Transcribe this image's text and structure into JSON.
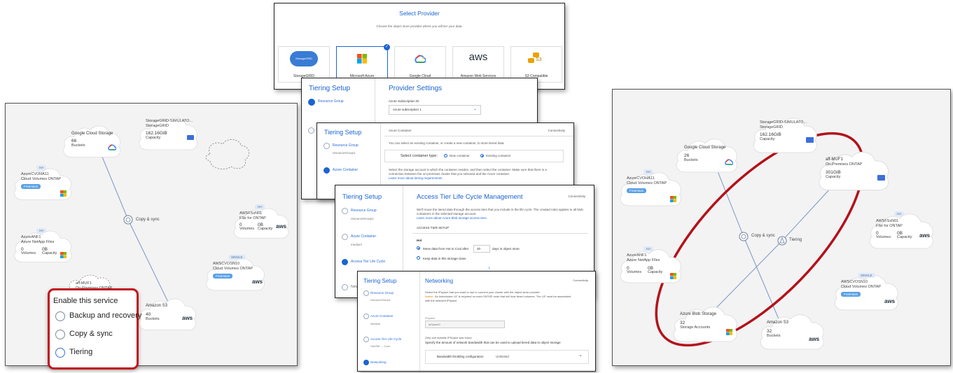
{
  "left_canvas": {
    "gcs": {
      "title": "Google Cloud Storage",
      "value": "66",
      "unit": "Buckets"
    },
    "sgrid": {
      "title": "StorageGRID-SIMULATO...",
      "subtitle": "StorageGRID",
      "value": "162.16GiB",
      "unit": "Capacity"
    },
    "azha": {
      "tag": "HA",
      "title": "AzureCVOHA11",
      "subtitle": "Cloud Volumes ONTAP",
      "badge": "Freemium"
    },
    "anf": {
      "tag": "HA",
      "title": "AzureANF1",
      "subtitle": "Azure NetApp Files",
      "v1": "0",
      "l1": "Volumes",
      "v2": "0B",
      "l2": "Capacity"
    },
    "fsx": {
      "tag": "HA",
      "title": "AWSFSxN01",
      "subtitle": "FSx for ONTAP",
      "v1": "0",
      "l1": "Volumes",
      "v2": "0B",
      "l2": "Capacity"
    },
    "cvo": {
      "tag": "SINGLE",
      "title": "AWSCVOSN10",
      "subtitle": "Cloud Volumes ONTAP",
      "badge": "Freemium"
    },
    "s3": {
      "title": "Amazon S3",
      "value": "40",
      "unit": "Buckets"
    },
    "copy_sync": "Copy & sync",
    "partial": "aff-MUF1",
    "partial2": "On-Premises ONTAP"
  },
  "enable_menu": {
    "title": "Enable this service",
    "items": [
      "Backup and recovery",
      "Copy & sync",
      "Tiering"
    ]
  },
  "select_provider": {
    "title": "Select Provider",
    "subtitle": "Choose the object store provider where you will tier your data.",
    "providers": [
      {
        "name": "StorageGRID",
        "logo": "StorageGRID"
      },
      {
        "name": "Microsoft Azure"
      },
      {
        "name": "Google Cloud"
      },
      {
        "name": "Amazon Web Services",
        "logo": "aws"
      },
      {
        "name": "S3 Compatible",
        "logo": "S3"
      }
    ]
  },
  "panel1": {
    "title": "Tiering Setup",
    "heading": "Provider Settings",
    "step": "Resource Group",
    "field_label": "Azure Subscription ID",
    "field_value": "Azure subscription 1"
  },
  "panel2": {
    "title": "Tiering Setup",
    "step1": "Resource Group",
    "step1_sub": "resourceGroup1",
    "step2": "Azure Container",
    "section": "Azure Container",
    "connectivity": "Connectivity",
    "desc": "You can select an existing container, or create a new container, to store tiered data.",
    "select_label": "Select container type:",
    "opt_new": "New container",
    "opt_existing": "Existing container",
    "note": "Select the storage account in which the container resides, and then select the container. Make sure that there is a",
    "note2": "connection between the on-premises cluster that you selected and the Azure container.",
    "link": "Learn more about tiering requirements"
  },
  "panel3": {
    "title": "Tiering Setup",
    "heading": "Access Tier Life Cycle Management",
    "connectivity": "Connectivity",
    "step1": "Resource Group",
    "step1_sub": "resourceGroup1",
    "step2": "Azure Container",
    "step2_sub": "medium",
    "step3": "Access Tier Life Cycle",
    "step4": "Netw",
    "desc1": "We'll move the tiered data through the access tiers that you include in the life cycle. The created rules applies to all blob",
    "desc2": "containers in the selected storage account.",
    "link": "Learn more about Azure Blob storage access tiers",
    "section": "ACCESS TIER SETUP",
    "hot": "Hot",
    "move_label": "Move data from Hot to Cool after",
    "move_days": "30",
    "move_suffix": "days in object store",
    "keep_label": "Keep data in this storage class"
  },
  "panel4": {
    "title": "Tiering Setup",
    "heading": "Networking",
    "connectivity": "Connectivity",
    "step1": "Resource Group",
    "step1_sub": "resourceGroup1",
    "step2": "Azure Container",
    "step2_sub": "medium",
    "step3": "Access Tier Life Cycle",
    "step3_sub": "Hot/Std → Cool",
    "step4": "Networking",
    "desc": "Select the IPspace that you want to use to connect your cluster with the object store provider.",
    "notice_label": "Notice:",
    "notice": "An Intercluster LIF is required on each ONTAP node that will host tiered volumes. The LIF must be associated",
    "notice2": "with the selected IPspace.",
    "ipspace_label": "IPspace",
    "ipspace_value": "ipSpace0",
    "found": "Only one suitable IPSpace was found",
    "bandwidth_desc": "Specify the amount of network bandwidth that can be used to upload tiered data to object storage",
    "bandwidth_label": "Bandwidth throttling configuration",
    "bandwidth_value": "Unlimited"
  },
  "right_canvas": {
    "gcs": {
      "title": "Google Cloud Storage",
      "value": "26",
      "unit": "Buckets"
    },
    "sgrid": {
      "title": "StorageGRID-SIMULATO...",
      "subtitle": "StorageGRID",
      "value": "162.16GiB",
      "unit": "Capacity"
    },
    "aff": {
      "title": "aff-MUF1",
      "subtitle": "On-Premises ONTAP",
      "value": "301GiB",
      "unit": "Capacity"
    },
    "azha": {
      "tag": "HA",
      "title": "AzureCVOHA11",
      "subtitle": "Cloud Volumes ONTAP",
      "badge": "Freemium"
    },
    "fsx": {
      "tag": "HA",
      "title": "AWSFSxN01",
      "subtitle": "FSx for ONTAP",
      "v1": "0",
      "l1": "Volumes",
      "v2": "0B",
      "l2": "Capacity"
    },
    "anf": {
      "tag": "HA",
      "title": "AzureANF1",
      "subtitle": "Azure NetApp Files",
      "v1": "0",
      "l1": "Volumes",
      "v2": "0B",
      "l2": "Capacity"
    },
    "cvo": {
      "tag": "SINGLE",
      "title": "AWSCVOSN10",
      "subtitle": "Cloud Volumes ONTAP",
      "badge": "Freemium"
    },
    "blob": {
      "title": "Azure Blob Storage",
      "value": "32",
      "unit": "Storage Accounts"
    },
    "s3": {
      "title": "Amazon S3",
      "value": "32",
      "unit": "Buckets"
    },
    "copy_sync": "Copy & sync",
    "tiering": "Tiering"
  },
  "colors": {
    "accent": "#1b64d2",
    "highlight": "#c0141c",
    "freemium": "#5aa0e6"
  }
}
